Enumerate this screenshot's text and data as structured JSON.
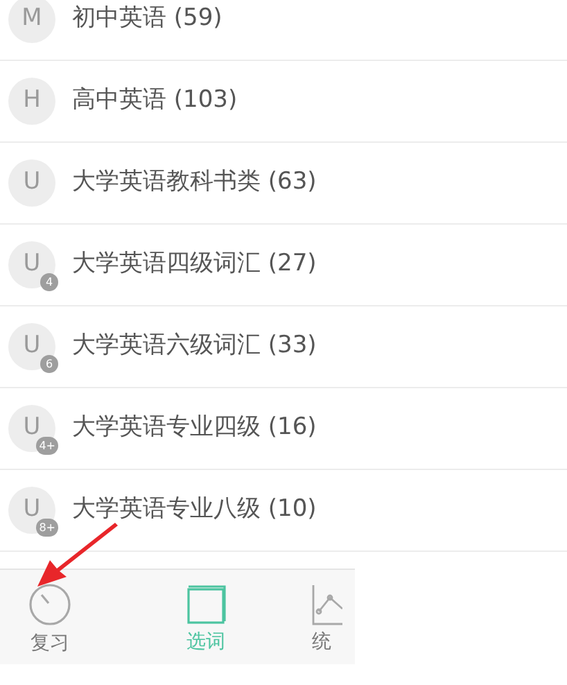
{
  "books": [
    {
      "letter": "M",
      "title": "初中英语 (59)"
    },
    {
      "letter": "H",
      "title": "高中英语 (103)"
    },
    {
      "letter": "U",
      "title": "大学英语教科书类 (63)"
    },
    {
      "letter": "U",
      "badge": "4",
      "title": "大学英语四级词汇 (27)"
    },
    {
      "letter": "U",
      "badge": "6",
      "title": "大学英语六级词汇 (33)"
    },
    {
      "letter": "U",
      "badge": "4+",
      "title": "大学英语专业四级 (16)"
    },
    {
      "letter": "U",
      "badge": "8+",
      "title": "大学英语专业八级 (10)"
    }
  ],
  "tabs": [
    {
      "kind": "review",
      "label": "复习",
      "selected": false
    },
    {
      "kind": "words",
      "label": "选词",
      "selected": true
    },
    {
      "kind": "stats",
      "label": "统",
      "selected": false
    }
  ]
}
